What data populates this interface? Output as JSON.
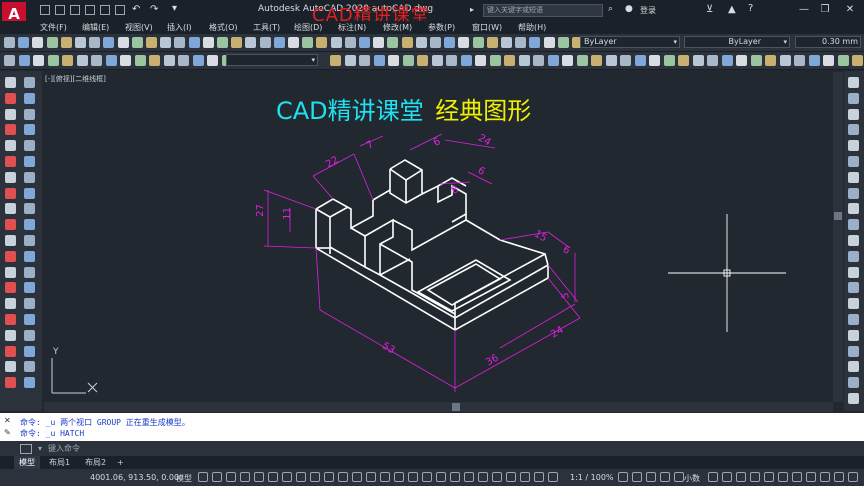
{
  "window": {
    "title": "Autodesk AutoCAD 2020    autoCAD.dwg",
    "watermark": "CAD精讲课堂",
    "search_placeholder": "键入关键字或短语",
    "login_label": "登录",
    "app_logo": "A"
  },
  "menu": [
    "文件(F)",
    "编辑(E)",
    "视图(V)",
    "插入(I)",
    "格式(O)",
    "工具(T)",
    "绘图(D)",
    "标注(N)",
    "修改(M)",
    "参数(P)",
    "窗口(W)",
    "帮助(H)"
  ],
  "layer_combos": {
    "color": "ByLayer",
    "linetype": "ByLayer",
    "lineweight": "0.30 mm"
  },
  "drawing": {
    "viewport_label": "[-][俯视][二维线框]",
    "heading_part1": "CAD精讲课堂",
    "heading_part2": "经典图形",
    "dimensions": [
      "22",
      "7",
      "6",
      "24",
      "6",
      "27",
      "11",
      "8",
      "15",
      "6",
      "5",
      "53",
      "24",
      "36"
    ],
    "ucs_y": "Y",
    "colors": {
      "accent_cyan": "#20e0f0",
      "accent_yellow": "#f0f000",
      "dim_magenta": "#e020e0",
      "model": "#ffffff"
    }
  },
  "command": {
    "history": [
      "命令: _u 两个视口 GROUP 正在重生成模型。",
      "命令: _u HATCH"
    ],
    "input_placeholder": "键入命令"
  },
  "tabs": [
    "模型",
    "布局1",
    "布局2",
    "+"
  ],
  "status": {
    "coords": "4001.06, 913.50, 0.00",
    "space": "模型",
    "scale": "1:1 / 100%",
    "units": "小数"
  }
}
